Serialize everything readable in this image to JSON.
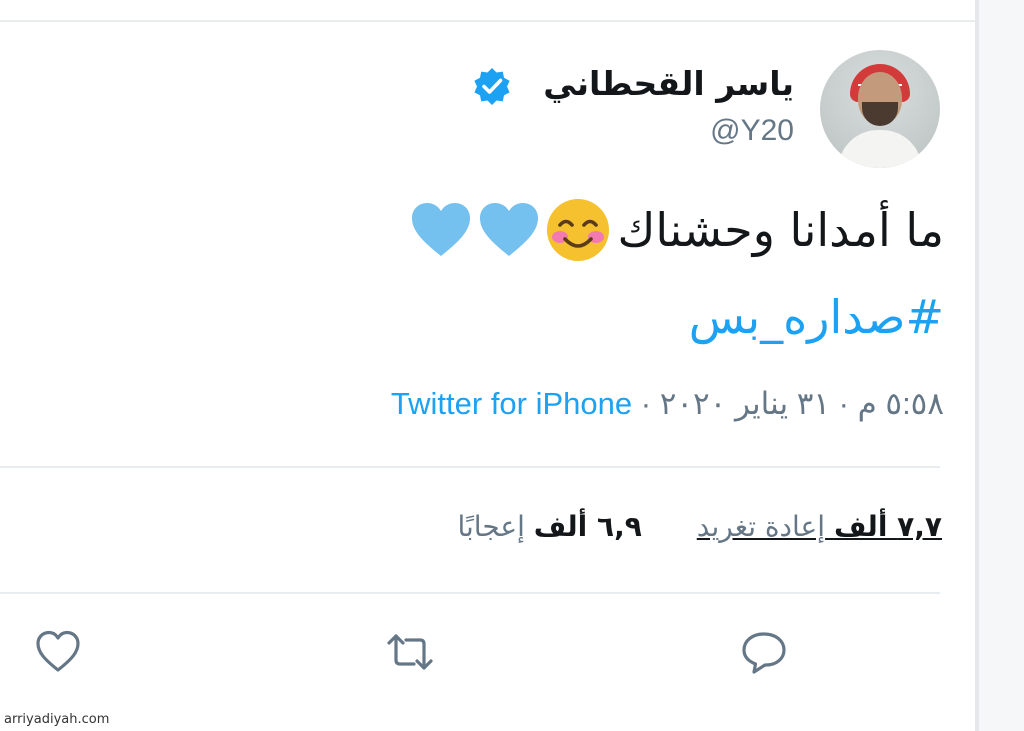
{
  "user": {
    "display_name": "ياسر القحطاني",
    "handle": "@Y20",
    "verified": true,
    "avatar_label": "avatar"
  },
  "tweet": {
    "text": "ما أمدانا وحشناك",
    "emojis": [
      "smiling-face-with-smiling-eyes",
      "light-blue-heart",
      "light-blue-heart"
    ],
    "hashtag": "#صداره_بس"
  },
  "meta": {
    "time": "٥:٥٨ م",
    "separator": "·",
    "date": "٣١ يناير ٢٠٢٠",
    "source": "Twitter for iPhone"
  },
  "stats": {
    "retweets_count": "٧,٧ ألف",
    "retweets_label": "إعادة تغريد",
    "likes_count": "٦,٩ ألف",
    "likes_label": "إعجابًا"
  },
  "actions": {
    "reply_icon": "reply-icon",
    "retweet_icon": "retweet-icon",
    "like_icon": "like-icon"
  },
  "colors": {
    "accent": "#1da1f2",
    "text": "#14171a",
    "muted": "#657786",
    "divider": "#e6ecf0",
    "heart": "#74c0ef",
    "emoji_face": "#f5c12e"
  },
  "watermark": "arriyadiyah.com"
}
